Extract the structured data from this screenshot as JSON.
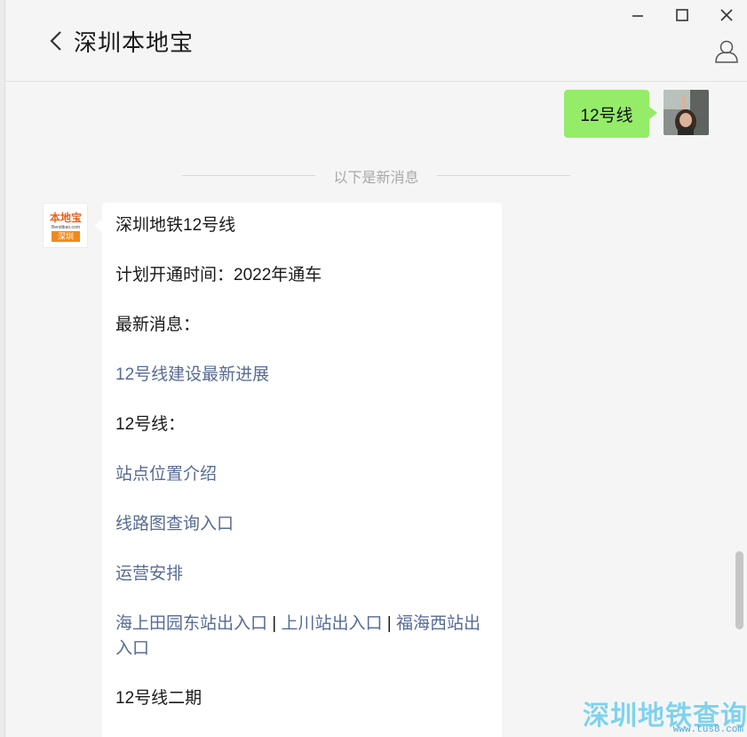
{
  "header": {
    "title": "深圳本地宝"
  },
  "window_controls": {
    "minimize": "minimize-icon",
    "maximize": "maximize-icon",
    "close": "close-icon"
  },
  "chat": {
    "outgoing": {
      "text": "12号线"
    },
    "divider_text": "以下是新消息",
    "bot_avatar": {
      "top": "本地宝",
      "mid": "Bendibao.com",
      "bottom": "深圳"
    },
    "incoming": {
      "title": "深圳地铁12号线",
      "open_time": "计划开通时间：2022年通车",
      "latest_label": "最新消息：",
      "link_progress": "12号线建设最新进展",
      "line_label": "12号线：",
      "link_stations": "站点位置介绍",
      "link_map": "线路图查询入口",
      "link_schedule": "运营安排",
      "link_exits_1": "海上田园东站出入口",
      "sep1": " | ",
      "link_exits_2": "上川站出入口",
      "sep2": " | ",
      "link_exits_3": "福海西站出入口",
      "phase2": "12号线二期"
    }
  },
  "watermark": {
    "main": "深圳地铁查询",
    "url": "www.tus8.com"
  },
  "colors": {
    "outgoing_bubble": "#95ec69",
    "link": "#576b95",
    "background": "#f5f5f5"
  }
}
